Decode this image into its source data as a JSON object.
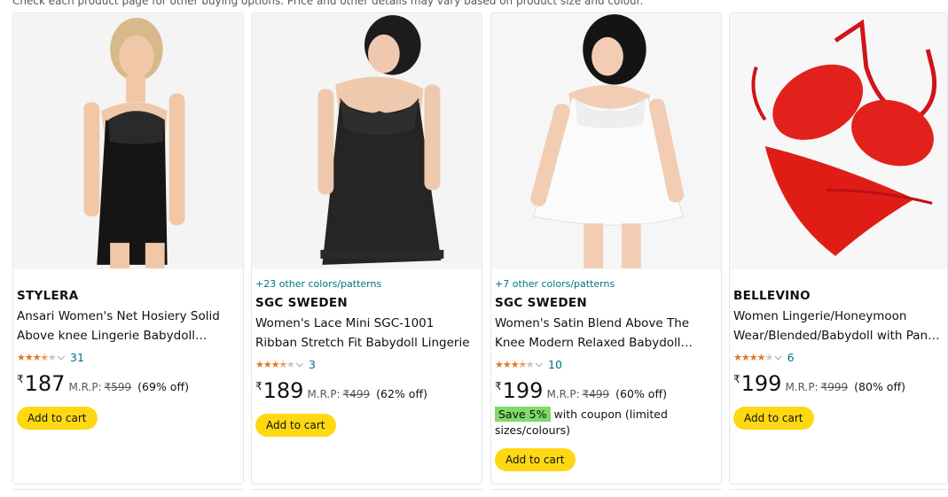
{
  "notice": "Check each product page for other buying options. Price and other details may vary based on product size and colour.",
  "cart_label": "Add to cart",
  "currency_symbol": "₹",
  "mrp_label": "M.R.P:",
  "products": [
    {
      "image_icon": "product-image-black-net-babydoll",
      "colors_link": "",
      "brand": "STYLERA",
      "title": "Ansari Women's Net Hosiery Solid Above knee Lingerie Babydoll Nightwear with Thong",
      "rating": 3.5,
      "rating_count": "31",
      "price": "187",
      "mrp": "₹599",
      "discount": "(69% off)",
      "coupon_badge": "",
      "coupon_text": ""
    },
    {
      "image_icon": "product-image-black-lace-babydoll",
      "colors_link": "+23 other colors/patterns",
      "brand": "SGC SWEDEN",
      "title": "Women's Lace Mini SGC-1001 Ribban Stretch Fit Babydoll Lingerie",
      "rating": 3.5,
      "rating_count": "3",
      "price": "189",
      "mrp": "₹499",
      "discount": "(62% off)",
      "coupon_badge": "",
      "coupon_text": ""
    },
    {
      "image_icon": "product-image-white-satin-babydoll",
      "colors_link": "+7 other colors/patterns",
      "brand": "SGC SWEDEN",
      "title": "Women's Satin Blend Above The Knee Modern Relaxed Babydoll Nikker Top",
      "rating": 3.5,
      "rating_count": "10",
      "price": "199",
      "mrp": "₹499",
      "discount": "(60% off)",
      "coupon_badge": "Save 5%",
      "coupon_text": "with coupon (limited sizes/colours)"
    },
    {
      "image_icon": "product-image-red-lace-set",
      "colors_link": "",
      "brand": "BELLEVINO",
      "title": "Women Lingerie/Honeymoon Wear/Blended/Babydoll with Panty Lace Set",
      "rating": 4.0,
      "rating_count": "6",
      "price": "199",
      "mrp": "₹999",
      "discount": "(80% off)",
      "coupon_badge": "",
      "coupon_text": ""
    }
  ],
  "colors": {
    "link": "#007185",
    "star": "#de7921",
    "cart_button": "#ffd814",
    "coupon_badge": "#7fda69"
  }
}
